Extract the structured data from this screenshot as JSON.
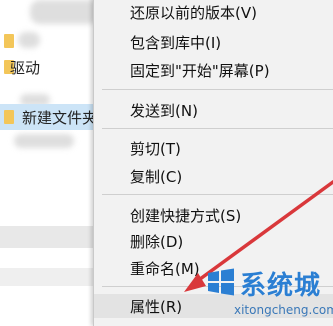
{
  "explorer": {
    "tree": [
      {
        "label": ""
      },
      {
        "label": "驱动"
      },
      {
        "label": "新建文件夹"
      }
    ]
  },
  "context_menu": {
    "items": [
      {
        "label": "还原以前的版本(V)"
      },
      {
        "label": "包含到库中(I)"
      },
      {
        "label": "固定到\"开始\"屏幕(P)"
      },
      {
        "label": "发送到(N)"
      },
      {
        "label": "剪切(T)"
      },
      {
        "label": "复制(C)"
      },
      {
        "label": "创建快捷方式(S)"
      },
      {
        "label": "删除(D)"
      },
      {
        "label": "重命名(M)"
      },
      {
        "label": "属性(R)"
      }
    ],
    "highlighted": "属性(R)"
  },
  "annotation": {
    "arrow_color": "#d9383b"
  },
  "watermark": {
    "brand": "系统城",
    "site": "xitongcheng.com",
    "brand_color": "#2b7fd3"
  }
}
